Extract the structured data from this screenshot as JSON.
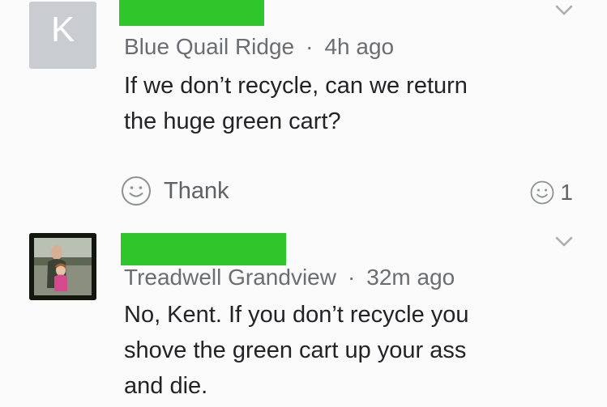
{
  "posts": [
    {
      "avatar_letter": "K",
      "author": "Blue Quail Ridge",
      "separator": "·",
      "time": "4h ago",
      "text": "If we don’t recycle, can we return the huge green cart?",
      "thank_label": "Thank",
      "thank_count": "1"
    },
    {
      "author": "Treadwell Grandview",
      "separator": "·",
      "time": "32m ago",
      "text": "No, Kent. If you don’t recycle you shove the green cart up your ass and die."
    }
  ],
  "colors": {
    "redaction": "#2ec62b",
    "avatar_bg": "#c9ccd1",
    "meta_text": "#6a6d72",
    "body_text": "#232327",
    "background": "#fbfbfb"
  },
  "icons": {
    "menu": "chevron-down-icon",
    "thank": "smiley-icon"
  }
}
